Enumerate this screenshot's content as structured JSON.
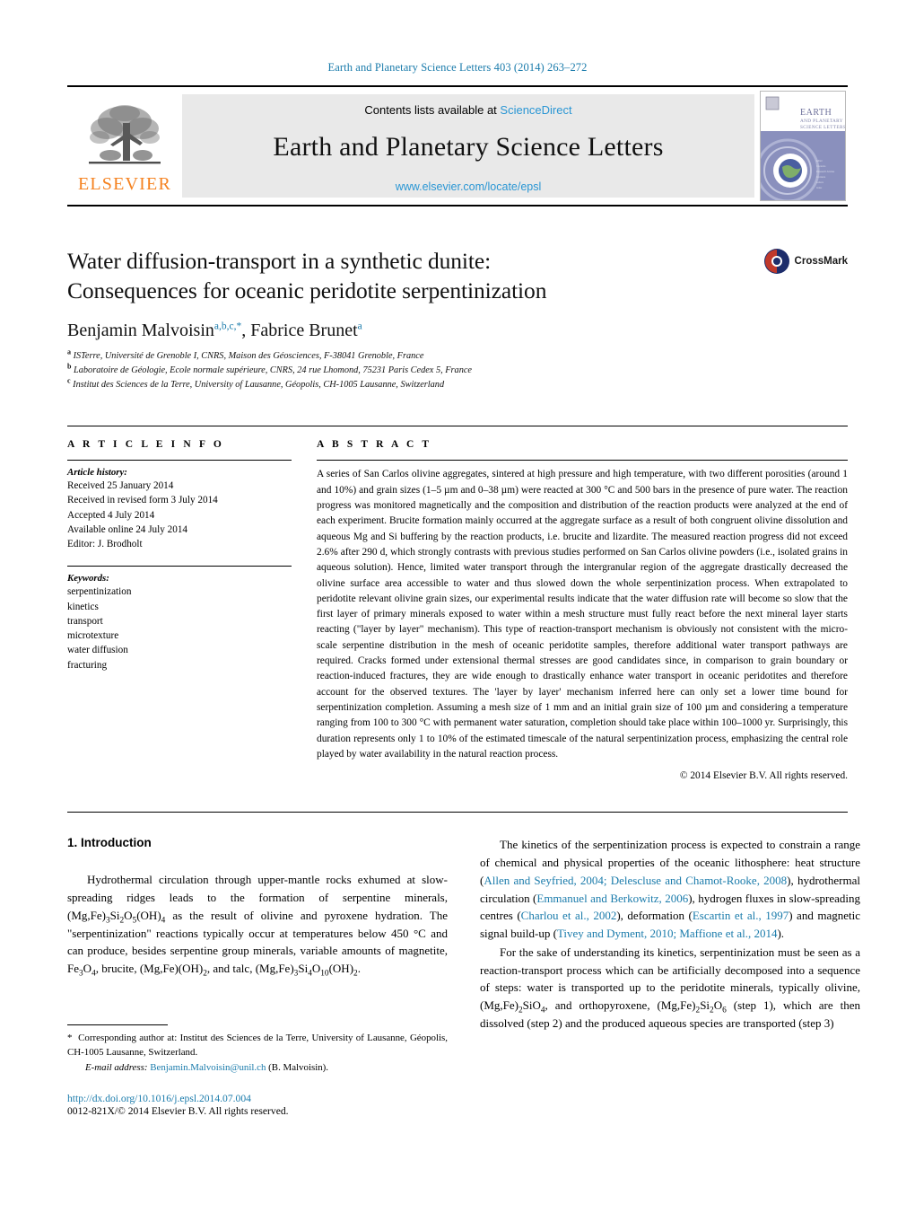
{
  "running_head": "Earth and Planetary Science Letters 403 (2014) 263–272",
  "masthead": {
    "contents_prefix": "Contents lists available at ",
    "sciencedirect": "ScienceDirect",
    "journal_title": "Earth and Planetary Science Letters",
    "journal_url": "www.elsevier.com/locate/epsl",
    "publisher_wordmark": "ELSEVIER",
    "cover_title_line1": "EARTH",
    "cover_title_line2": "AND PLANETARY",
    "cover_title_line3": "SCIENCE LETTERS"
  },
  "article": {
    "title_line1": "Water diffusion-transport in a synthetic dunite:",
    "title_line2": "Consequences for oceanic peridotite serpentinization",
    "author1": "Benjamin Malvoisin",
    "author1_sups": "a,b,c,",
    "author1_star": "*",
    "author_sep": ", ",
    "author2": "Fabrice Brunet",
    "author2_sup": "a",
    "affiliations": [
      {
        "mark": "a",
        "text": "ISTerre, Université de Grenoble I, CNRS, Maison des Géosciences, F-38041 Grenoble, France"
      },
      {
        "mark": "b",
        "text": "Laboratoire de Géologie, Ecole normale supérieure, CNRS, 24 rue Lhomond, 75231 Paris Cedex 5, France"
      },
      {
        "mark": "c",
        "text": "Institut des Sciences de la Terre, University of Lausanne, Géopolis, CH-1005 Lausanne, Switzerland"
      }
    ],
    "crossmark_label": "CrossMark"
  },
  "article_info": {
    "heading": "A R T I C L E    I N F O",
    "history_label": "Article history:",
    "history": [
      "Received 25 January 2014",
      "Received in revised form 3 July 2014",
      "Accepted 4 July 2014",
      "Available online 24 July 2014",
      "Editor: J. Brodholt"
    ],
    "keywords_label": "Keywords:",
    "keywords": [
      "serpentinization",
      "kinetics",
      "transport",
      "microtexture",
      "water diffusion",
      "fracturing"
    ]
  },
  "abstract": {
    "heading": "A B S T R A C T",
    "text": "A series of San Carlos olivine aggregates, sintered at high pressure and high temperature, with two different porosities (around 1 and 10%) and grain sizes (1–5 µm and 0–38 µm) were reacted at 300 °C and 500 bars in the presence of pure water. The reaction progress was monitored magnetically and the composition and distribution of the reaction products were analyzed at the end of each experiment. Brucite formation mainly occurred at the aggregate surface as a result of both congruent olivine dissolution and aqueous Mg and Si buffering by the reaction products, i.e. brucite and lizardite. The measured reaction progress did not exceed 2.6% after 290 d, which strongly contrasts with previous studies performed on San Carlos olivine powders (i.e., isolated grains in aqueous solution). Hence, limited water transport through the intergranular region of the aggregate drastically decreased the olivine surface area accessible to water and thus slowed down the whole serpentinization process. When extrapolated to peridotite relevant olivine grain sizes, our experimental results indicate that the water diffusion rate will become so slow that the first layer of primary minerals exposed to water within a mesh structure must fully react before the next mineral layer starts reacting (\"layer by layer\" mechanism). This type of reaction-transport mechanism is obviously not consistent with the micro-scale serpentine distribution in the mesh of oceanic peridotite samples, therefore additional water transport pathways are required. Cracks formed under extensional thermal stresses are good candidates since, in comparison to grain boundary or reaction-induced fractures, they are wide enough to drastically enhance water transport in oceanic peridotites and therefore account for the observed textures. The 'layer by layer' mechanism inferred here can only set a lower time bound for serpentinization completion. Assuming a mesh size of 1 mm and an initial grain size of 100 µm and considering a temperature ranging from 100 to 300 °C with permanent water saturation, completion should take place within 100–1000 yr. Surprisingly, this duration represents only 1 to 10% of the estimated timescale of the natural serpentinization process, emphasizing the central role played by water availability in the natural reaction process.",
    "copyright": "© 2014 Elsevier B.V. All rights reserved."
  },
  "body": {
    "section_title": "1. Introduction",
    "left_paragraph_parts": {
      "p1_a": "Hydrothermal circulation through upper-mantle rocks exhumed at slow-spreading ridges leads to the formation of serpentine minerals, (Mg,Fe)",
      "p1_sub1": "3",
      "p1_b": "Si",
      "p1_sub2": "2",
      "p1_c": "O",
      "p1_sub3": "5",
      "p1_d": "(OH)",
      "p1_sub4": "4",
      "p1_e": " as the result of olivine and pyroxene hydration. The \"serpentinization\" reactions typically occur at temperatures below 450 °C and can produce, besides serpentine group minerals, variable amounts of magnetite, Fe",
      "p1_sub5": "3",
      "p1_f": "O",
      "p1_sub6": "4",
      "p1_g": ", brucite, (Mg,Fe)(OH)",
      "p1_sub7": "2",
      "p1_h": ", and talc, (Mg,Fe)",
      "p1_sub8": "3",
      "p1_i": "Si",
      "p1_sub9": "4",
      "p1_j": "O",
      "p1_sub10": "10",
      "p1_k": "(OH)",
      "p1_sub11": "2",
      "p1_l": "."
    },
    "right_p1_pre": "The kinetics of the serpentinization process is expected to constrain a range of chemical and physical properties of the oceanic lithosphere: heat structure (",
    "right_cite1": "Allen and Seyfried, 2004; Delescluse and Chamot-Rooke, 2008",
    "right_p1_mid1": "), hydrothermal circulation (",
    "right_cite2": "Emmanuel and Berkowitz, 2006",
    "right_p1_mid2": "), hydrogen fluxes in slow-spreading centres (",
    "right_cite3": "Charlou et al., 2002",
    "right_p1_mid3": "), deformation (",
    "right_cite4": "Escartin et al., 1997",
    "right_p1_mid4": ") and magnetic signal build-up (",
    "right_cite5": "Tivey and Dyment, 2010; Maffione et al., 2014",
    "right_p1_end": ").",
    "right_p2_a": "For the sake of understanding its kinetics, serpentinization must be seen as a reaction-transport process which can be artificially decomposed into a sequence of steps: water is transported up to the peridotite minerals, typically olivine, (Mg,Fe)",
    "right_p2_sub1": "2",
    "right_p2_b": "SiO",
    "right_p2_sub2": "4",
    "right_p2_c": ", and orthopyroxene, (Mg,Fe)",
    "right_p2_sub3": "2",
    "right_p2_d": "Si",
    "right_p2_sub4": "2",
    "right_p2_e": "O",
    "right_p2_sub5": "6",
    "right_p2_f": " (step 1), which are then dissolved (step 2) and the produced aqueous species are transported (step 3)"
  },
  "footer": {
    "corresponding_star": "*",
    "corresponding": "Corresponding author at: Institut des Sciences de la Terre, University of Lausanne, Géopolis, CH-1005 Lausanne, Switzerland.",
    "email_label": "E-mail address:",
    "email": "Benjamin.Malvoisin@unil.ch",
    "email_suffix": "(B. Malvoisin).",
    "doi": "http://dx.doi.org/10.1016/j.epsl.2014.07.004",
    "issn_line": "0012-821X/© 2014 Elsevier B.V. All rights reserved."
  },
  "colors": {
    "link": "#1a7bab",
    "elsevier_orange": "#f58220",
    "sciencedirect_blue": "#2a96d4"
  }
}
